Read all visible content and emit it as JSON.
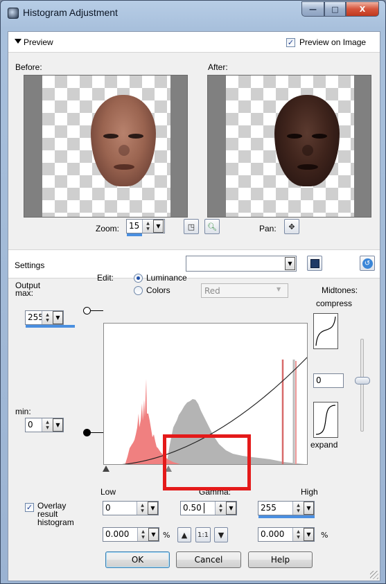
{
  "window": {
    "title": "Histogram Adjustment",
    "min_glyph": "—",
    "max_glyph": "□",
    "close_glyph": "X"
  },
  "preview": {
    "header_label": "Preview",
    "preview_on_image_label": "Preview on Image",
    "preview_on_image_checked": true,
    "before_label": "Before:",
    "after_label": "After:",
    "zoom_label": "Zoom:",
    "zoom_value": "15",
    "pan_label": "Pan:"
  },
  "settings": {
    "label": "Settings",
    "preset_value": ""
  },
  "edit": {
    "label": "Edit:",
    "luminance_label": "Luminance",
    "colors_label": "Colors",
    "channel_value": "Red",
    "mode": "luminance"
  },
  "output": {
    "max_label": "Output\nmax:",
    "max_value": "255",
    "min_label": "min:",
    "min_value": "0"
  },
  "midtones": {
    "label": "Midtones:",
    "compress_label": "compress",
    "value": "0",
    "expand_label": "expand"
  },
  "levels": {
    "low_label": "Low",
    "gamma_label": "Gamma:",
    "high_label": "High",
    "low_value": "0",
    "gamma_value": "0.50",
    "high_value": "255",
    "low_pct": "0.000",
    "high_pct": "0.000",
    "pct_symbol": "%",
    "one_to_one": "1:1"
  },
  "overlay": {
    "label": "Overlay\nresult\nhistogram",
    "checked": true
  },
  "buttons": {
    "ok": "OK",
    "cancel": "Cancel",
    "help": "Help"
  }
}
